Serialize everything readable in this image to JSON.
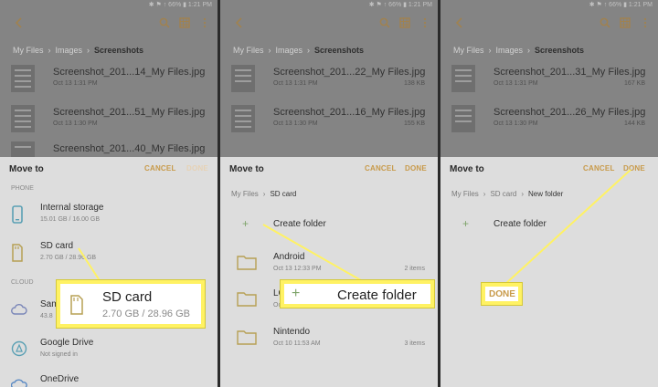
{
  "status_text": "✱ ⚑ ↑ 66% ▮ 1:21 PM",
  "colors": {
    "accent": "#c89a4a",
    "highlight": "#fff263",
    "plus": "#7ea46a"
  },
  "icons": [
    "back-arrow-icon",
    "search-icon",
    "grid-icon",
    "more-vert-icon",
    "phone-icon",
    "sd-card-icon",
    "cloud-icon",
    "google-drive-icon",
    "onedrive-icon",
    "folder-icon",
    "plus-icon"
  ],
  "panel1": {
    "crumbs": [
      "My Files",
      "Images",
      "Screenshots"
    ],
    "files": [
      {
        "name": "Screenshot_201...14_My Files.jpg",
        "date": "Oct 13 1:31 PM",
        "size": ""
      },
      {
        "name": "Screenshot_201...51_My Files.jpg",
        "date": "Oct 13 1:30 PM",
        "size": ""
      },
      {
        "name": "Screenshot_201...40_My Files.jpg",
        "date": "",
        "size": ""
      }
    ],
    "sheet": {
      "title": "Move to",
      "cancel": "CANCEL",
      "done": "DONE",
      "section_phone": "PHONE",
      "section_cloud": "CLOUD",
      "options": [
        {
          "label": "Internal storage",
          "sub": "15.01 GB / 16.00 GB"
        },
        {
          "label": "SD card",
          "sub": "2.70 GB / 28.96 GB"
        },
        {
          "label": "Sam",
          "sub": "43.8"
        },
        {
          "label": "Google Drive",
          "sub": "Not signed in"
        },
        {
          "label": "OneDrive",
          "sub": ""
        }
      ]
    },
    "callout": {
      "label": "SD card",
      "sub": "2.70 GB / 28.96 GB"
    }
  },
  "panel2": {
    "crumbs": [
      "My Files",
      "Images",
      "Screenshots"
    ],
    "files": [
      {
        "name": "Screenshot_201...22_My Files.jpg",
        "date": "Oct 13 1:31 PM",
        "size": "138 KB"
      },
      {
        "name": "Screenshot_201...16_My Files.jpg",
        "date": "Oct 13 1:30 PM",
        "size": "155 KB"
      },
      {
        "name": "",
        "date": "",
        "size": ""
      }
    ],
    "sheet": {
      "title": "Move to",
      "cancel": "CANCEL",
      "done": "DONE",
      "crumbs": [
        "My Files",
        "SD card"
      ],
      "create_folder": "Create folder",
      "folders": [
        {
          "name": "Android",
          "date": "Oct 13 12:33 PM",
          "count": "2 items"
        },
        {
          "name": "LO",
          "date": "Oct 13",
          "count": ""
        },
        {
          "name": "Nintendo",
          "date": "Oct 10 11:53 AM",
          "count": "3 items"
        }
      ]
    },
    "callout": {
      "label": "Create folder"
    }
  },
  "panel3": {
    "crumbs": [
      "My Files",
      "Images",
      "Screenshots"
    ],
    "files": [
      {
        "name": "Screenshot_201...31_My Files.jpg",
        "date": "Oct 13 1:31 PM",
        "size": "167 KB"
      },
      {
        "name": "Screenshot_201...26_My Files.jpg",
        "date": "Oct 13 1:30 PM",
        "size": "144 KB"
      },
      {
        "name": "",
        "date": "",
        "size": ""
      }
    ],
    "sheet": {
      "title": "Move to",
      "cancel": "CANCEL",
      "done": "DONE",
      "crumbs": [
        "My Files",
        "SD card",
        "New folder"
      ],
      "create_folder": "Create folder"
    },
    "callout": {
      "label": "DONE"
    }
  }
}
